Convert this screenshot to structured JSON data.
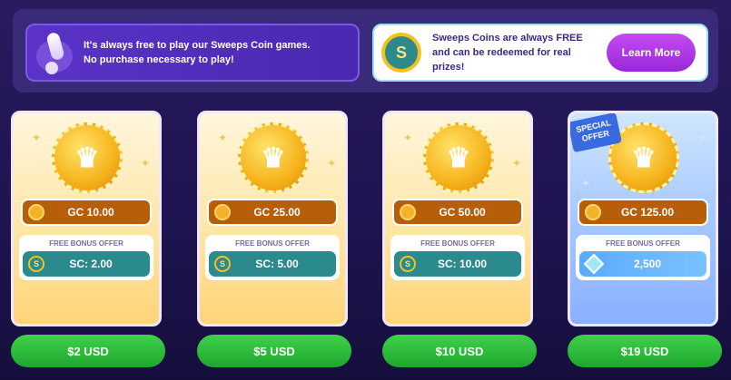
{
  "banner": {
    "left_text": "It's always free to play our Sweeps Coin games.\nNo purchase necessary to play!",
    "right_text": "Sweeps Coins are always FREE and can be redeemed for real prizes!",
    "sc_icon_glyph": "S",
    "learn_more_label": "Learn More"
  },
  "packages": [
    {
      "gc": "GC 10.00",
      "bonus_label": "FREE BONUS OFFER",
      "sc": "SC: 2.00",
      "price": "$2 USD"
    },
    {
      "gc": "GC 25.00",
      "bonus_label": "FREE BONUS OFFER",
      "sc": "SC: 5.00",
      "price": "$5 USD"
    },
    {
      "gc": "GC 50.00",
      "bonus_label": "FREE BONUS OFFER",
      "sc": "SC: 10.00",
      "price": "$10 USD"
    },
    {
      "gc": "GC 125.00",
      "bonus_label": "FREE BONUS OFFER",
      "sc": "2,500",
      "price": "$19 USD",
      "ribbon": "SPECIAL OFFER"
    }
  ],
  "colors": {
    "accent_purple": "#9a28d8",
    "buy_green": "#1fa52e",
    "gc_orange": "#b65e0a",
    "sc_teal": "#2a8a8e"
  }
}
